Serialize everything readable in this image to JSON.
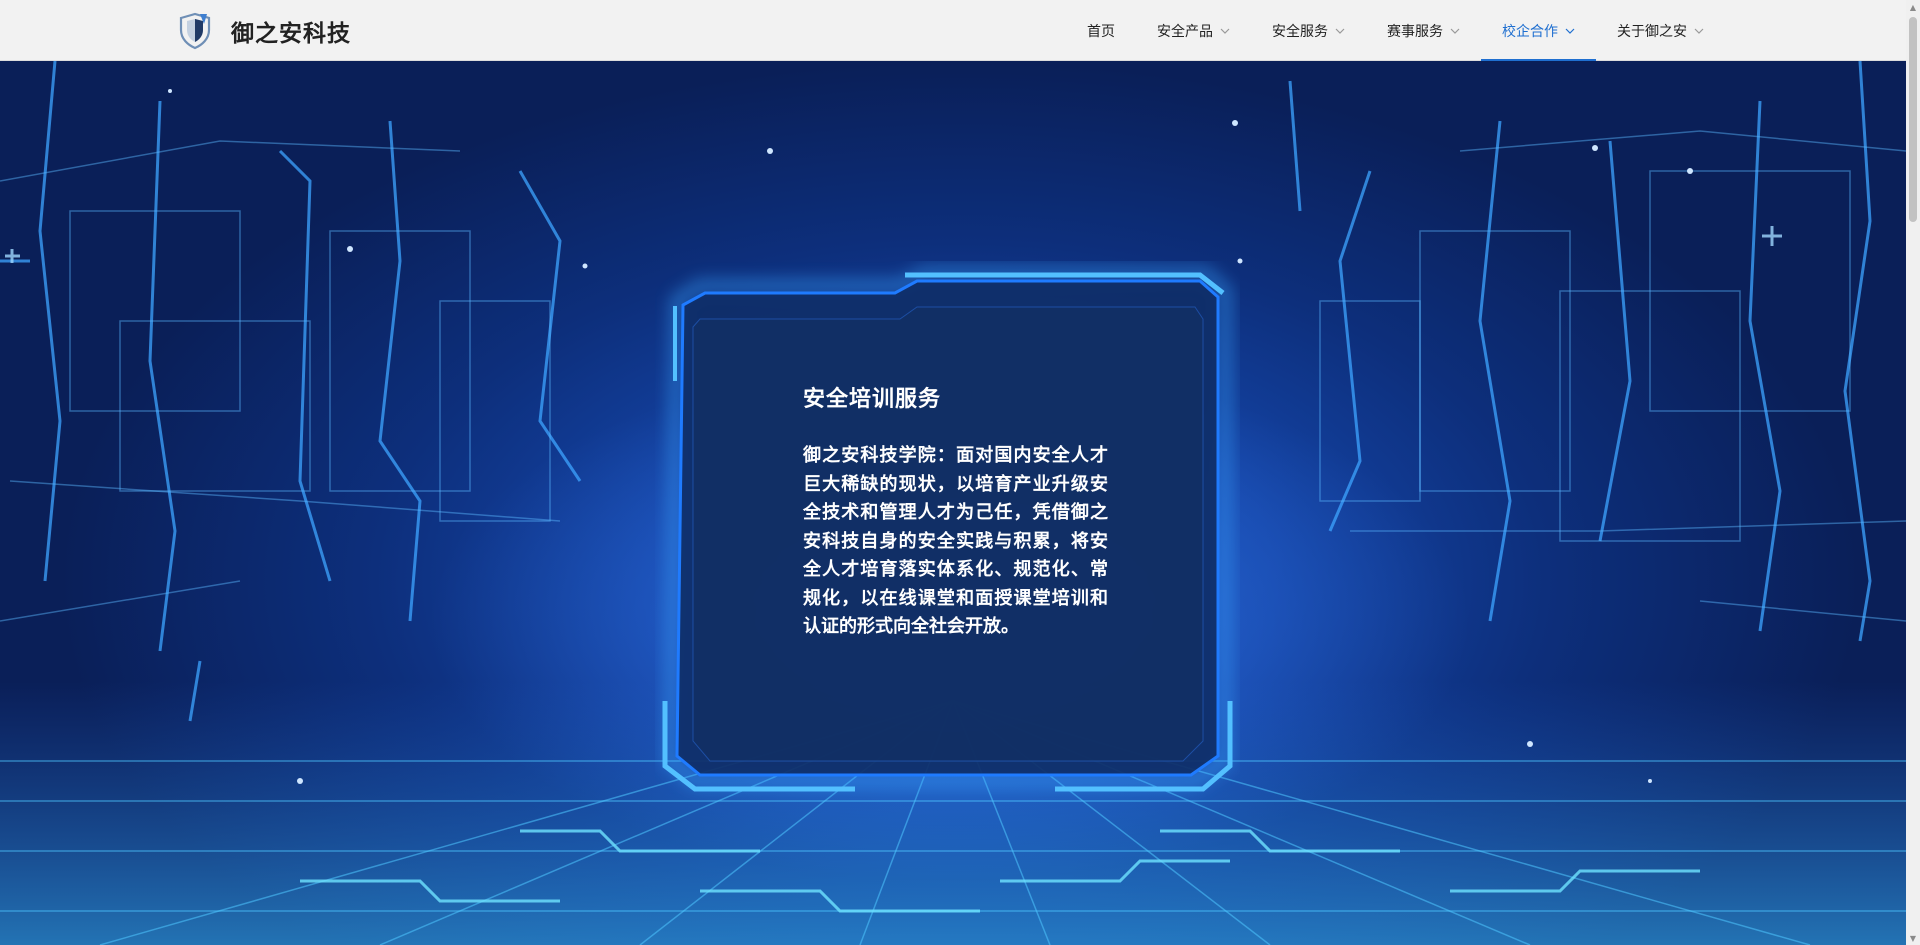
{
  "brand": {
    "name": "御之安科技",
    "logo_icon": "shield-logo-icon",
    "accent": "#1f6fd0"
  },
  "nav": {
    "items": [
      {
        "label": "首页",
        "dropdown": false,
        "active": false
      },
      {
        "label": "安全产品",
        "dropdown": true,
        "active": false
      },
      {
        "label": "安全服务",
        "dropdown": true,
        "active": false
      },
      {
        "label": "赛事服务",
        "dropdown": true,
        "active": false
      },
      {
        "label": "校企合作",
        "dropdown": true,
        "active": true
      },
      {
        "label": "关于御之安",
        "dropdown": true,
        "active": false
      }
    ]
  },
  "hero": {
    "title": "安全培训服务",
    "description": "御之安科技学院：面对国内安全人才巨大稀缺的现状，以培育产业升级安全技术和管理人才为己任，凭借御之安科技自身的安全实践与积累，将安全人才培育落实体系化、规范化、常规化，以在线课堂和面授课堂培训和认证的形式向全社会开放。"
  }
}
